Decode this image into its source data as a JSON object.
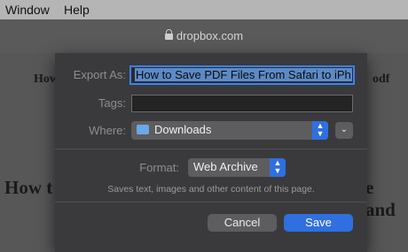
{
  "menubar": {
    "window": "Window",
    "help": "Help"
  },
  "browser": {
    "address": "dropbox.com"
  },
  "page_bg": {
    "heading_fragment_left": "How",
    "heading_fragment_right": "odf",
    "large_left": "How t",
    "large_right": "e and"
  },
  "sheet": {
    "export_as_label": "Export As:",
    "export_as_value": "How to Save PDF Files From Safari to iPh",
    "tags_label": "Tags:",
    "tags_value": "",
    "where_label": "Where:",
    "where_value": "Downloads",
    "expand_icon": "chevron-down",
    "format_label": "Format:",
    "format_value": "Web Archive",
    "format_hint": "Saves text, images and other content of this page.",
    "cancel_label": "Cancel",
    "save_label": "Save"
  },
  "colors": {
    "accent": "#2f6fe0",
    "sheet_bg": "#3a3a3c"
  }
}
